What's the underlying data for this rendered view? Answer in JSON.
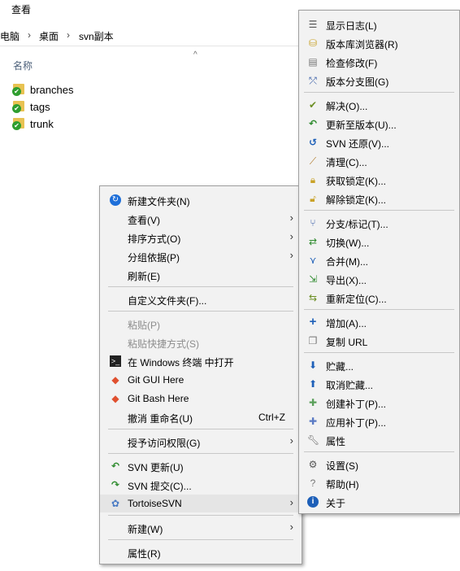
{
  "menubar": {
    "view": "查看"
  },
  "address": {
    "part1": "电脑",
    "part2": "桌面",
    "part3": "svn副本",
    "chev": "›"
  },
  "columns": {
    "name": "名称",
    "sort": "^"
  },
  "files": [
    "branches",
    "tags",
    "trunk"
  ],
  "context_menu": {
    "new_folder": "新建文件夹(N)",
    "view": "查看(V)",
    "sort": "排序方式(O)",
    "group": "分组依据(P)",
    "refresh": "刷新(E)",
    "customize": "自定义文件夹(F)...",
    "paste": "粘贴(P)",
    "paste_shortcut": "粘贴快捷方式(S)",
    "open_terminal": "在 Windows 终端 中打开",
    "git_gui": "Git GUI Here",
    "git_bash": "Git Bash Here",
    "undo_rename": "撤消 重命名(U)",
    "undo_shortcut": "Ctrl+Z",
    "grant_access": "授予访问权限(G)",
    "svn_update": "SVN 更新(U)",
    "svn_commit": "SVN 提交(C)...",
    "tortoise": "TortoiseSVN",
    "new": "新建(W)",
    "properties": "属性(R)",
    "arrow": "›"
  },
  "tortoise_menu": {
    "show_log": "显示日志(L)",
    "repo_browser": "版本库浏览器(R)",
    "check_mods": "检查修改(F)",
    "revision_graph": "版本分支图(G)",
    "resolve": "解决(O)...",
    "update_rev": "更新至版本(U)...",
    "revert": "SVN 还原(V)...",
    "cleanup": "清理(C)...",
    "get_lock": "获取锁定(K)...",
    "release_lock": "解除锁定(K)...",
    "branch_tag": "分支/标记(T)...",
    "switch": "切换(W)...",
    "merge": "合并(M)...",
    "export": "导出(X)...",
    "relocate": "重新定位(C)...",
    "add": "增加(A)...",
    "copy_url": "复制 URL",
    "shelve": "贮藏...",
    "unshelve": "取消贮藏...",
    "create_patch": "创建补丁(P)...",
    "apply_patch": "应用补丁(P)...",
    "properties": "属性",
    "settings": "设置(S)",
    "help": "帮助(H)",
    "about": "关于"
  },
  "colors": {
    "menu_bg": "#f2f2f2",
    "highlight": "#e5e5e5",
    "folder": "#e8c252",
    "svn_ok": "#2f9e2f"
  }
}
